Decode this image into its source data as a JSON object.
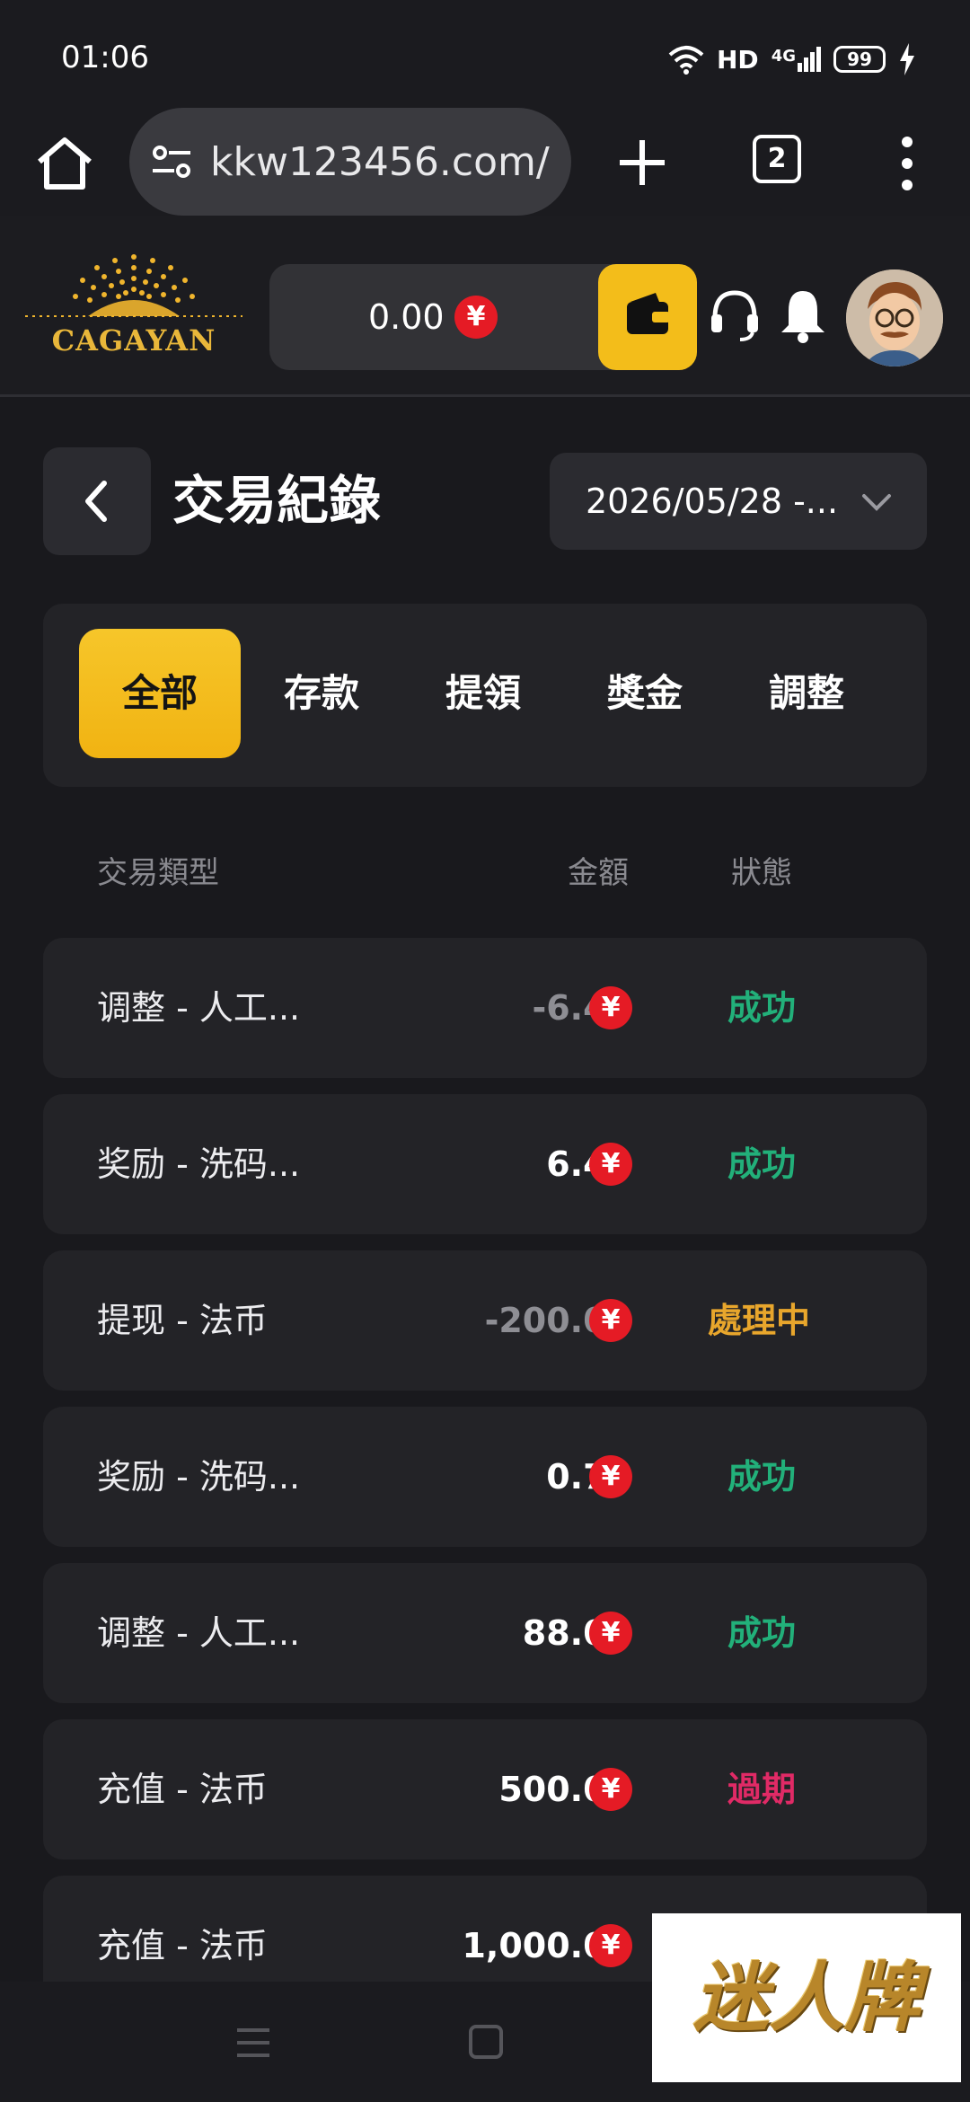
{
  "status_bar": {
    "time": "01:06",
    "hd": "HD",
    "network": "4G",
    "battery": "99"
  },
  "browser": {
    "url": "kkw123456.com/",
    "tab_count": "2"
  },
  "header": {
    "logo_text": "CAGAYAN",
    "balance": "0.00",
    "currency_symbol": "¥"
  },
  "page": {
    "title": "交易紀錄",
    "date_range": "2026/05/28 -..."
  },
  "filters": {
    "tabs": [
      "全部",
      "存款",
      "提領",
      "獎金",
      "調整"
    ],
    "active_index": 0
  },
  "table": {
    "headers": {
      "type": "交易類型",
      "amount": "金額",
      "status": "狀態"
    },
    "rows": [
      {
        "type": "调整 - 人工...",
        "amount": "-6.48",
        "status": "成功"
      },
      {
        "type": "奖励 - 洗码...",
        "amount": "6.41",
        "status": "成功"
      },
      {
        "type": "提现 - 法币",
        "amount": "-200.00",
        "status": "處理中"
      },
      {
        "type": "奖励 - 洗码...",
        "amount": "0.77",
        "status": "成功"
      },
      {
        "type": "调整 - 人工...",
        "amount": "88.00",
        "status": "成功"
      },
      {
        "type": "充值 - 法币",
        "amount": "500.00",
        "status": "過期"
      },
      {
        "type": "充值 - 法币",
        "amount": "1,000.00",
        "status": ""
      }
    ]
  },
  "watermark": {
    "text": "迷人牌"
  },
  "colors": {
    "accent": "#f3bd1a",
    "success": "#22b07a",
    "processing": "#e8a62c",
    "expired": "#e02a66",
    "negative_amount": "#8e8e94",
    "positive_amount": "#ffffff",
    "currency_badge": "#e51b25"
  }
}
